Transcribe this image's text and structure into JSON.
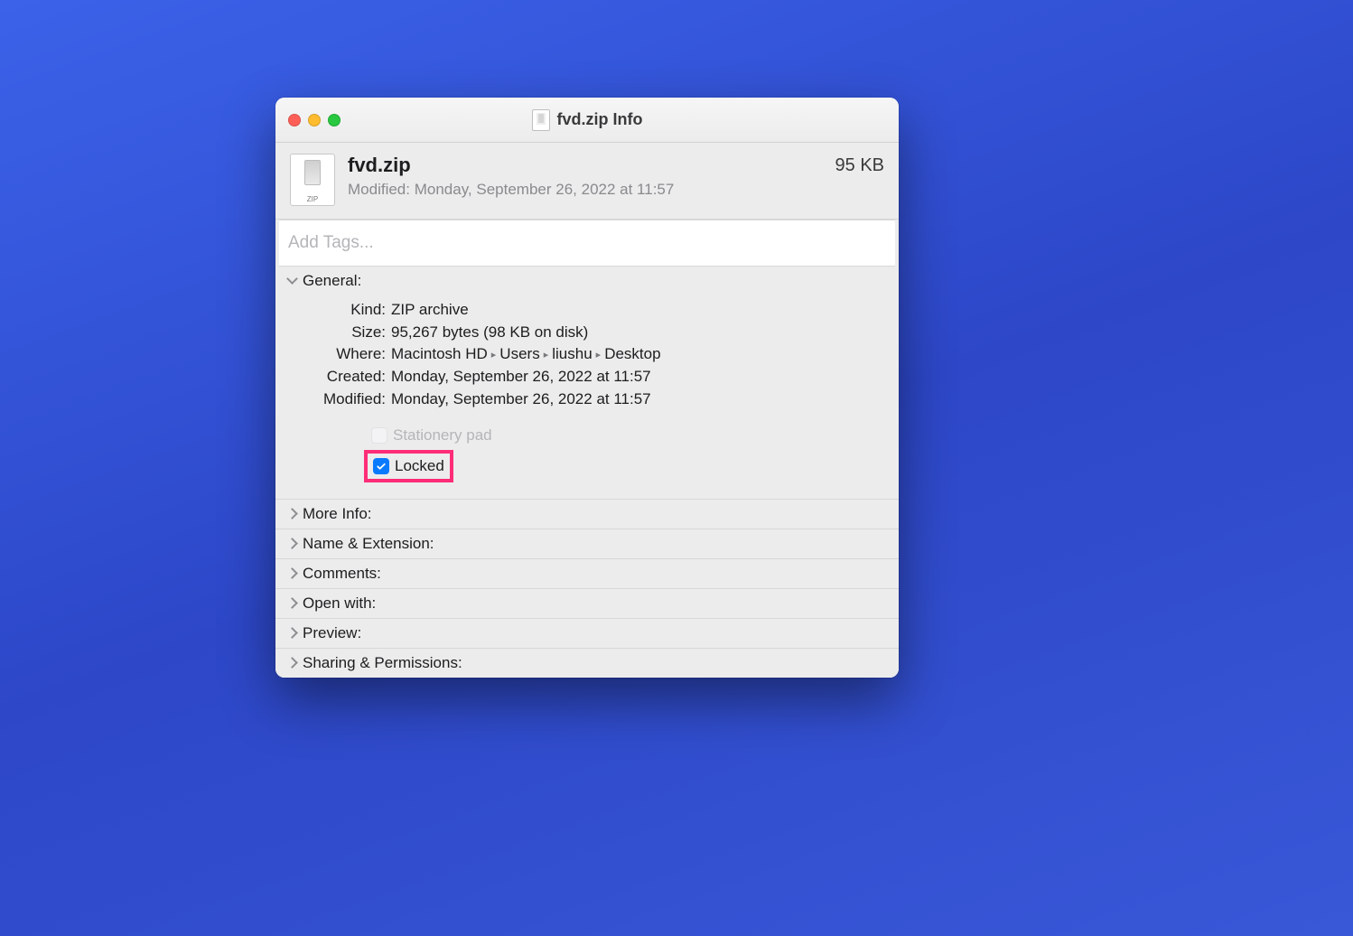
{
  "window": {
    "title": "fvd.zip Info"
  },
  "header": {
    "filename": "fvd.zip",
    "modified_prefix": "Modified:",
    "modified_value": "Monday, September 26, 2022 at 11:57",
    "size": "95 KB",
    "icon_badge": "ZIP"
  },
  "tags": {
    "placeholder": "Add Tags..."
  },
  "general": {
    "title": "General:",
    "fields": {
      "kind_label": "Kind:",
      "kind_value": "ZIP archive",
      "size_label": "Size:",
      "size_value": "95,267 bytes (98 KB on disk)",
      "where_label": "Where:",
      "where_segments": [
        "Macintosh HD",
        "Users",
        "liushu",
        "Desktop"
      ],
      "created_label": "Created:",
      "created_value": "Monday, September 26, 2022 at 11:57",
      "modified_label": "Modified:",
      "modified_value": "Monday, September 26, 2022 at 11:57"
    },
    "checks": {
      "stationery_label": "Stationery pad",
      "stationery_checked": false,
      "stationery_enabled": false,
      "locked_label": "Locked",
      "locked_checked": true,
      "locked_highlighted": true
    }
  },
  "sections": {
    "more_info": "More Info:",
    "name_ext": "Name & Extension:",
    "comments": "Comments:",
    "open_with": "Open with:",
    "preview": "Preview:",
    "sharing": "Sharing & Permissions:"
  }
}
